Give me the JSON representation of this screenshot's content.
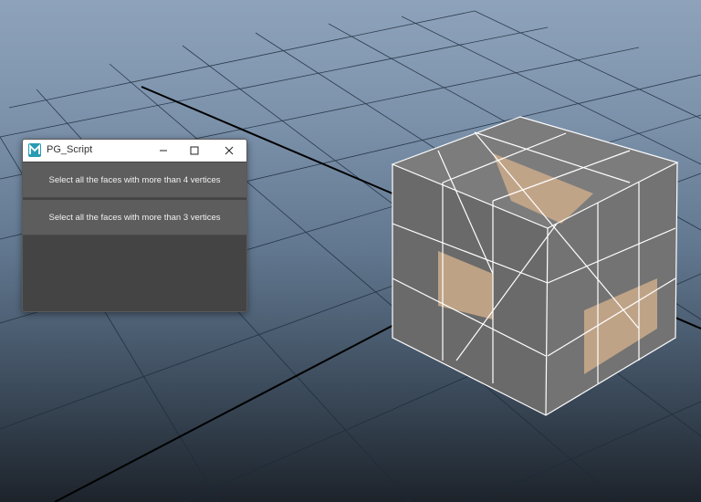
{
  "window": {
    "title": "PG_Script",
    "app_icon": "maya-m-icon",
    "controls": [
      "minimize-icon",
      "maximize-icon",
      "close-icon"
    ]
  },
  "buttons": [
    {
      "label": "Select all the faces with more than 4 vertices"
    },
    {
      "label": "Select all the faces with more than 3 vertices"
    }
  ],
  "colors": {
    "face_highlight": "#c8a88a",
    "wire_selected": "#ffffff",
    "cube_face": "#6e6e6e",
    "grid_line": "#1a2a3a"
  }
}
